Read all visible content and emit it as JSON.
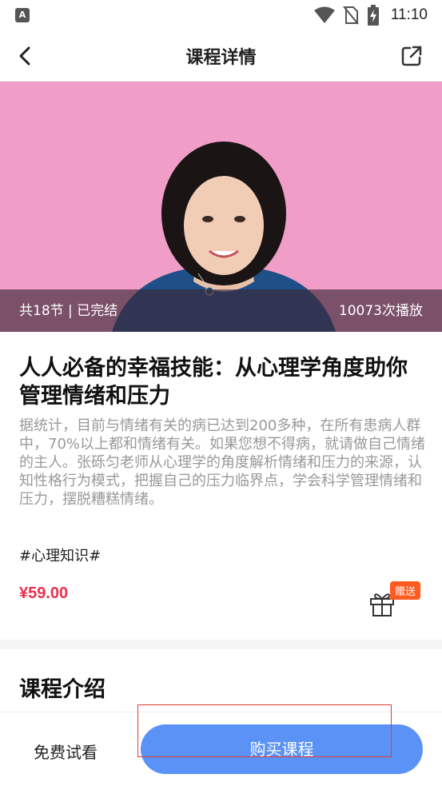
{
  "status_bar": {
    "app_badge": "A",
    "time": "11:10",
    "icons": [
      "wifi-icon",
      "no-sim-icon",
      "battery-charging-icon"
    ]
  },
  "nav": {
    "title": "课程详情",
    "back_icon": "back-arrow-icon",
    "share_icon": "share-icon"
  },
  "hero": {
    "lessons_text": "共18节 | 已完结",
    "plays_text": "10073次播放",
    "background_color": "#f09ec8"
  },
  "course": {
    "title": "人人必备的幸福技能：从心理学角度助你管理情绪和压力",
    "description": "据统计，目前与情绪有关的病已达到200多种，在所有患病人群中，70%以上都和情绪有关。如果您想不得病，就请做自己情绪的主人。张砾匀老师从心理学的角度解析情绪和压力的来源，认知性格行为模式，把握自己的压力临界点，学会科学管理情绪和压力，摆脱糟糕情绪。",
    "tag": "#心理知识#",
    "price": "¥59.00",
    "gift_badge": "赠送",
    "price_color": "#e8314f"
  },
  "section": {
    "title": "课程介绍"
  },
  "bottom_bar": {
    "trial_label": "免费试看",
    "buy_label": "购买课程",
    "buy_color": "#5b92f5"
  }
}
